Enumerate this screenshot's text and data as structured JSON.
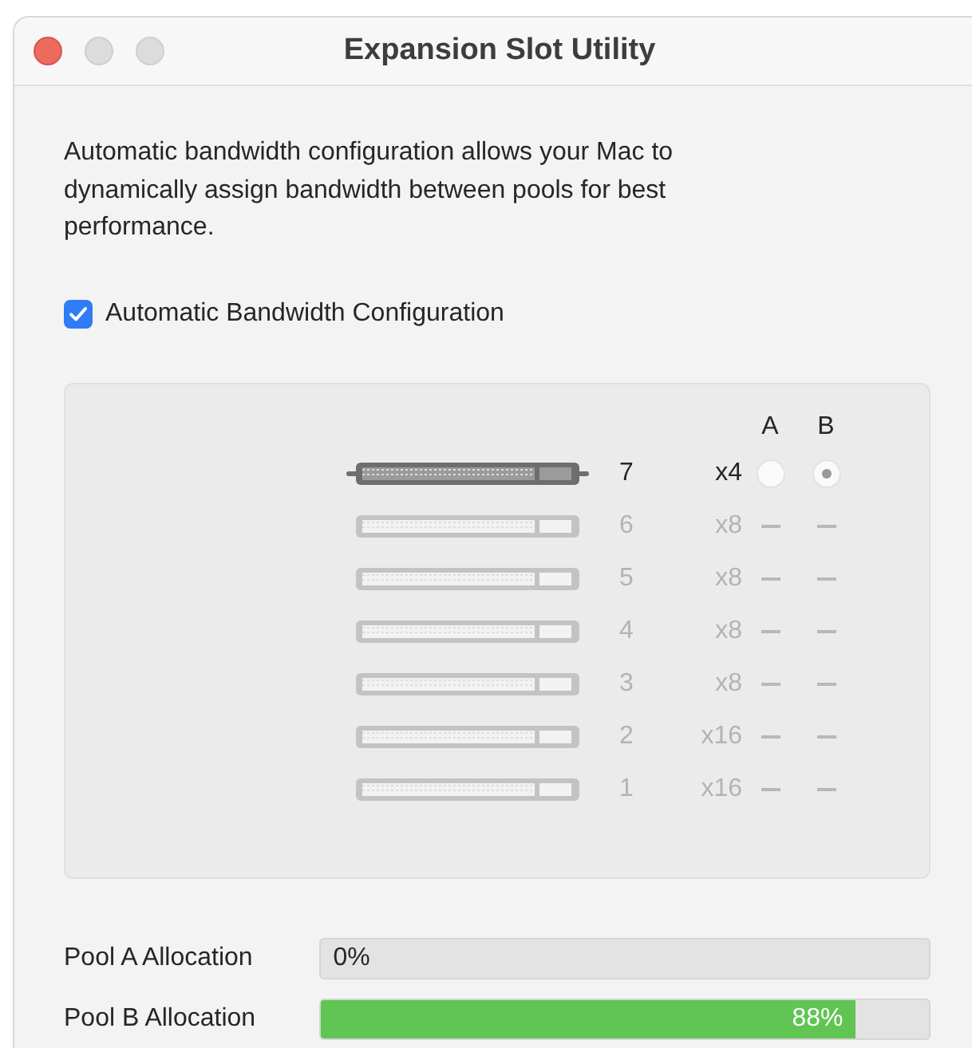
{
  "window": {
    "title": "Expansion Slot Utility"
  },
  "description": "Automatic bandwidth configuration allows your Mac to dynamically assign bandwidth between pools for best performance.",
  "auto_config": {
    "label": "Automatic Bandwidth Configuration",
    "checked": true
  },
  "slots": {
    "column_headers": [
      "A",
      "B"
    ],
    "rows": [
      {
        "number": "7",
        "lanes": "x4",
        "enabled": true,
        "kind": "radios",
        "pool_a": {
          "selected": false
        },
        "pool_b": {
          "selected": true
        }
      },
      {
        "number": "6",
        "lanes": "x8",
        "enabled": false,
        "kind": "dashes"
      },
      {
        "number": "5",
        "lanes": "x8",
        "enabled": false,
        "kind": "dashes"
      },
      {
        "number": "4",
        "lanes": "x8",
        "enabled": false,
        "kind": "dashes"
      },
      {
        "number": "3",
        "lanes": "x8",
        "enabled": false,
        "kind": "dashes"
      },
      {
        "number": "2",
        "lanes": "x16",
        "enabled": false,
        "kind": "dashes"
      },
      {
        "number": "1",
        "lanes": "x16",
        "enabled": false,
        "kind": "dashes"
      }
    ]
  },
  "pools": [
    {
      "label": "Pool A Allocation",
      "level": 0,
      "reading": "0%"
    },
    {
      "label": "Pool B Allocation",
      "level": 0.88,
      "reading": "88%"
    }
  ]
}
